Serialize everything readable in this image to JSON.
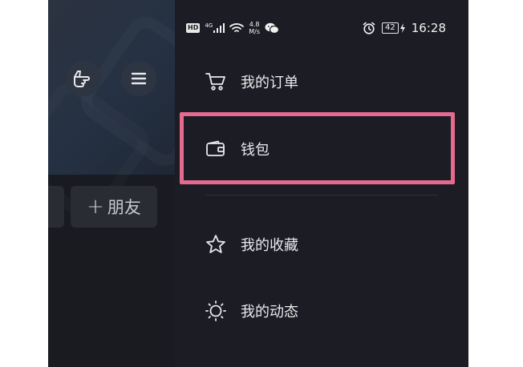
{
  "background_app": {
    "friend_button_label": "朋友",
    "friend_button_prefix": "+"
  },
  "status_bar": {
    "network_badge": "HD",
    "network_type": "4G",
    "speed_value": "4.8",
    "speed_unit": "M/s",
    "battery": "42",
    "time": "16:28"
  },
  "drawer": {
    "items": [
      {
        "label": "我的订单",
        "icon": "cart-icon"
      },
      {
        "label": "钱包",
        "icon": "wallet-icon"
      },
      {
        "label": "我的收藏",
        "icon": "star-icon"
      },
      {
        "label": "我的动态",
        "icon": "sun-icon"
      }
    ]
  },
  "colors": {
    "drawer_bg": "#1c1d24",
    "highlight_border": "#e56a8f",
    "text": "#e9e9ec"
  }
}
